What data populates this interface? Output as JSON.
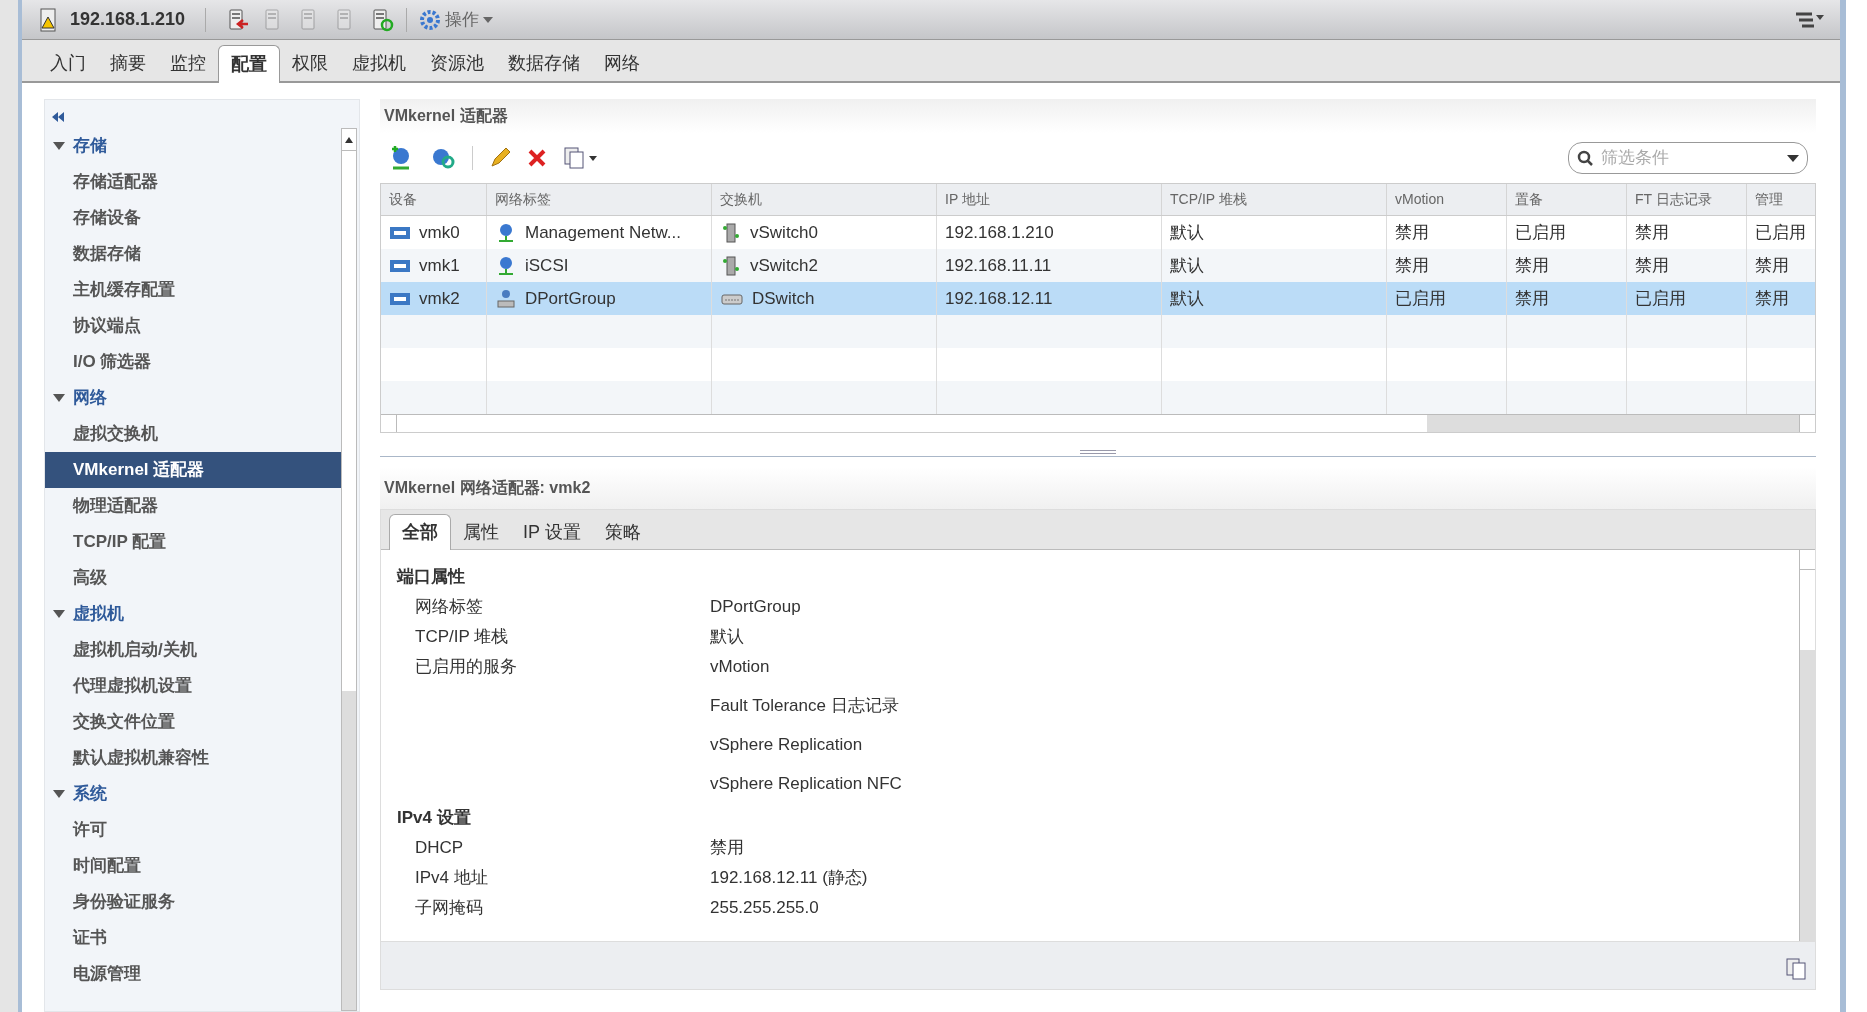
{
  "header": {
    "host": "192.168.1.210",
    "actions_menu": "操作"
  },
  "main_tabs": [
    {
      "label": "入门",
      "selected": false
    },
    {
      "label": "摘要",
      "selected": false
    },
    {
      "label": "监控",
      "selected": false
    },
    {
      "label": "配置",
      "selected": true
    },
    {
      "label": "权限",
      "selected": false
    },
    {
      "label": "虚拟机",
      "selected": false
    },
    {
      "label": "资源池",
      "selected": false
    },
    {
      "label": "数据存储",
      "selected": false
    },
    {
      "label": "网络",
      "selected": false
    }
  ],
  "sidebar": {
    "sections": [
      {
        "label": "存储",
        "expanded": true,
        "children": [
          {
            "label": "存储适配器",
            "selected": false
          },
          {
            "label": "存储设备",
            "selected": false
          },
          {
            "label": "数据存储",
            "selected": false
          },
          {
            "label": "主机缓存配置",
            "selected": false
          },
          {
            "label": "协议端点",
            "selected": false
          },
          {
            "label": "I/O 筛选器",
            "selected": false
          }
        ]
      },
      {
        "label": "网络",
        "expanded": true,
        "children": [
          {
            "label": "虚拟交换机",
            "selected": false
          },
          {
            "label": "VMkernel 适配器",
            "selected": true
          },
          {
            "label": "物理适配器",
            "selected": false
          },
          {
            "label": "TCP/IP 配置",
            "selected": false
          },
          {
            "label": "高级",
            "selected": false
          }
        ]
      },
      {
        "label": "虚拟机",
        "expanded": true,
        "children": [
          {
            "label": "虚拟机启动/关机",
            "selected": false
          },
          {
            "label": "代理虚拟机设置",
            "selected": false
          },
          {
            "label": "交换文件位置",
            "selected": false
          },
          {
            "label": "默认虚拟机兼容性",
            "selected": false
          }
        ]
      },
      {
        "label": "系统",
        "expanded": true,
        "children": [
          {
            "label": "许可",
            "selected": false
          },
          {
            "label": "时间配置",
            "selected": false
          },
          {
            "label": "身份验证服务",
            "selected": false
          },
          {
            "label": "证书",
            "selected": false
          },
          {
            "label": "电源管理",
            "selected": false
          }
        ]
      }
    ]
  },
  "adapters": {
    "title": "VMkernel 适配器",
    "filter": {
      "placeholder": "筛选条件"
    },
    "table": {
      "columns": [
        "设备",
        "网络标签",
        "交换机",
        "IP 地址",
        "TCP/IP 堆栈",
        "vMotion",
        "置备",
        "FT 日志记录",
        "管理"
      ],
      "rows": [
        {
          "selected": false,
          "kind": "standard",
          "cells": [
            "vmk0",
            "Management Netw...",
            "vSwitch0",
            "192.168.1.210",
            "默认",
            "禁用",
            "已启用",
            "禁用",
            "已启用"
          ]
        },
        {
          "selected": false,
          "kind": "standard",
          "cells": [
            "vmk1",
            "iSCSI",
            "vSwitch2",
            "192.168.11.11",
            "默认",
            "禁用",
            "禁用",
            "禁用",
            "禁用"
          ]
        },
        {
          "selected": true,
          "kind": "distributed",
          "cells": [
            "vmk2",
            "DPortGroup",
            "DSwitch",
            "192.168.12.11",
            "默认",
            "已启用",
            "禁用",
            "已启用",
            "禁用"
          ]
        }
      ]
    }
  },
  "details": {
    "title": "VMkernel 网络适配器: vmk2",
    "tabs": [
      {
        "label": "全部",
        "selected": true
      },
      {
        "label": "属性",
        "selected": false
      },
      {
        "label": "IP 设置",
        "selected": false
      },
      {
        "label": "策略",
        "selected": false
      }
    ],
    "sections": [
      {
        "heading": "端口属性",
        "rows": [
          {
            "label": "网络标签",
            "values": [
              "DPortGroup"
            ]
          },
          {
            "label": "TCP/IP 堆栈",
            "values": [
              "默认"
            ]
          },
          {
            "label": "已启用的服务",
            "values": [
              "vMotion",
              "Fault Tolerance 日志记录",
              "vSphere Replication",
              "vSphere Replication NFC"
            ]
          }
        ]
      },
      {
        "heading": "IPv4 设置",
        "rows": [
          {
            "label": "DHCP",
            "values": [
              "禁用"
            ]
          },
          {
            "label": "IPv4 地址",
            "values": [
              "192.168.12.11 (静态)"
            ]
          },
          {
            "label": "子网掩码",
            "values": [
              "255.255.255.0"
            ]
          }
        ]
      }
    ]
  }
}
